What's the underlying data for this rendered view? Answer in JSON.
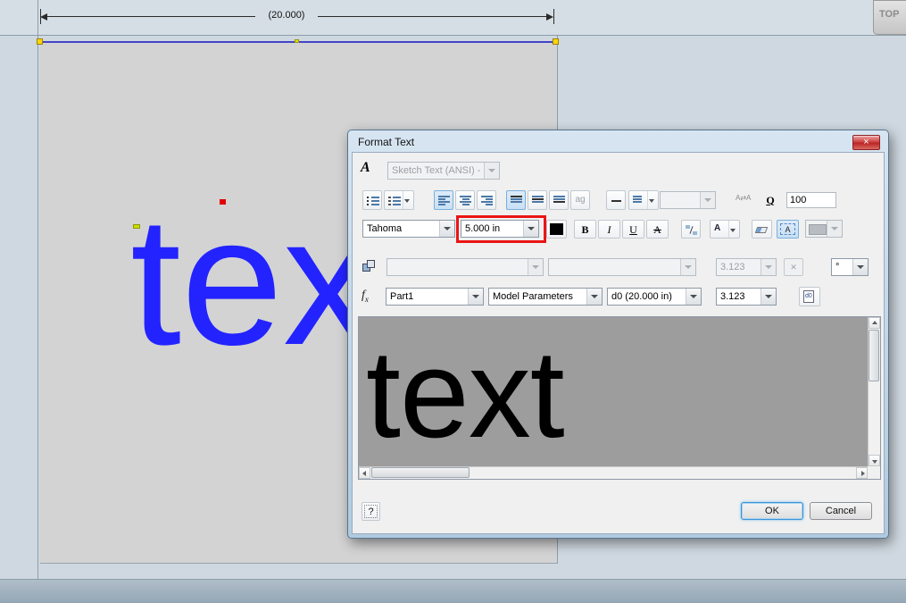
{
  "viewcube": {
    "label": "TOP"
  },
  "sketch": {
    "dimension": "(20.000)",
    "text": "text"
  },
  "dialog": {
    "title": "Format Text",
    "close": "×",
    "style_icon": "A",
    "style": {
      "value": "Sketch Text (ANSI) - :"
    },
    "toolbar": {
      "fit_label": "ag",
      "spacing_icon": "A⇄A",
      "rotate_label": "Q",
      "stretch_value": "100"
    },
    "font": {
      "family": "Tahoma",
      "size": "5.000 in",
      "bold": "B",
      "italic": "I",
      "underline": "U",
      "strike": "A",
      "case": "A",
      "boxed": "A"
    },
    "props": {
      "precision": "3.123",
      "clear": "✕",
      "degree": "°"
    },
    "params": {
      "fx": "f",
      "fx_sub": "x",
      "component": "Part1",
      "source": "Model Parameters",
      "parameter": "d0 (20.000 in)",
      "precision": "3.123",
      "insert": "d0"
    },
    "editor": {
      "text": "text"
    },
    "footer": {
      "help": "?",
      "ok": "OK",
      "cancel": "Cancel"
    }
  }
}
